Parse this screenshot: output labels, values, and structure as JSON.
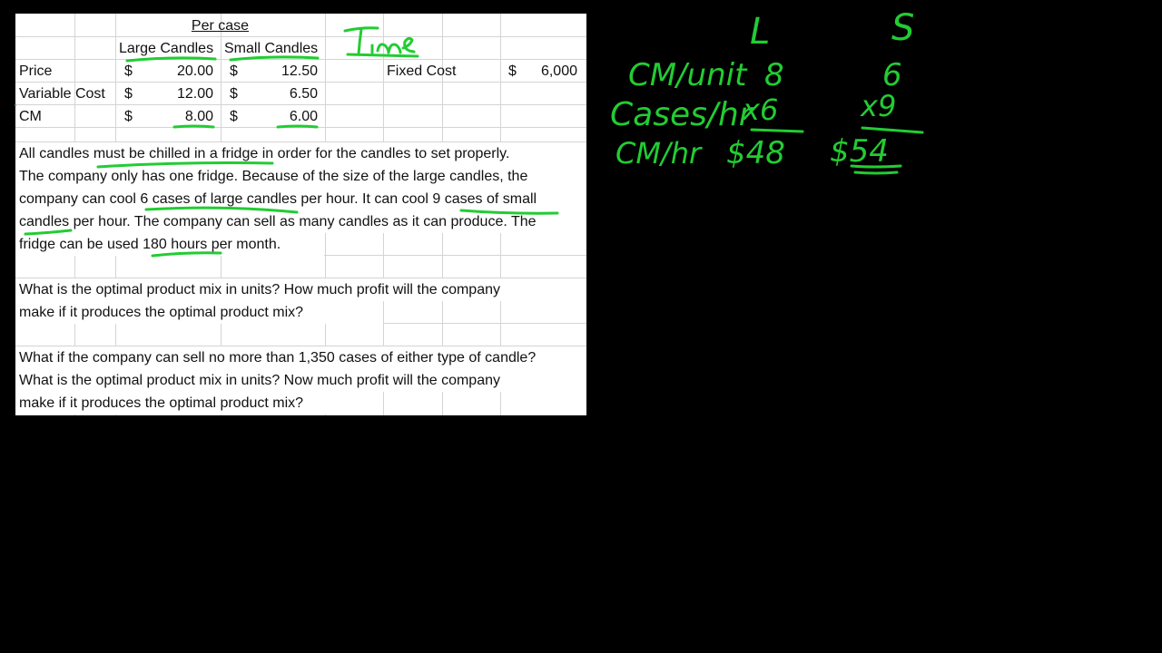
{
  "spreadsheet": {
    "header": {
      "group_label": "Per case",
      "col_large": "Large Candles",
      "col_small": "Small Candles"
    },
    "rows": [
      {
        "label": "Price",
        "large_currency": "$",
        "large_value": "20.00",
        "small_currency": "$",
        "small_value": "12.50"
      },
      {
        "label": "Variable Cost",
        "large_currency": "$",
        "large_value": "12.00",
        "small_currency": "$",
        "small_value": "6.50"
      },
      {
        "label": "CM",
        "large_currency": "$",
        "large_value": "8.00",
        "small_currency": "$",
        "small_value": "6.00"
      }
    ],
    "fixed_cost": {
      "label": "Fixed Cost",
      "currency": "$",
      "value": "6,000"
    },
    "paragraph_lines": [
      "All candles must be chilled in a fridge in order for the candles to set properly.",
      "The company only has one fridge. Because of the size of the large candles, the",
      "company can cool 6 cases of large candles per hour. It can cool 9 cases of small",
      "candles per hour. The company can sell as many candles as it can produce. The",
      "fridge can be used 180  hours per month."
    ],
    "question1_lines": [
      "What is the optimal product mix in units? How much profit will the company",
      "make if it  produces the optimal product mix?"
    ],
    "question2_lines": [
      "What if the company can sell no more than 1,350 cases of either type of candle?",
      "What is the optimal product mix in units? Now much profit will the company",
      "make if it produces the optimal product mix?"
    ]
  },
  "annotations": {
    "ink_color": "#22cc33",
    "time_label": "Time",
    "col_large_label": "L",
    "col_small_label": "S",
    "row_cm_unit": "CM/unit",
    "row_cases_hr": "Cases/hr",
    "row_cm_hr": "CM/hr",
    "large_cm_unit": "8",
    "small_cm_unit": "6",
    "large_cases_hr": "x6",
    "small_cases_hr": "x9",
    "large_cm_hr": "$48",
    "small_cm_hr": "$54"
  }
}
